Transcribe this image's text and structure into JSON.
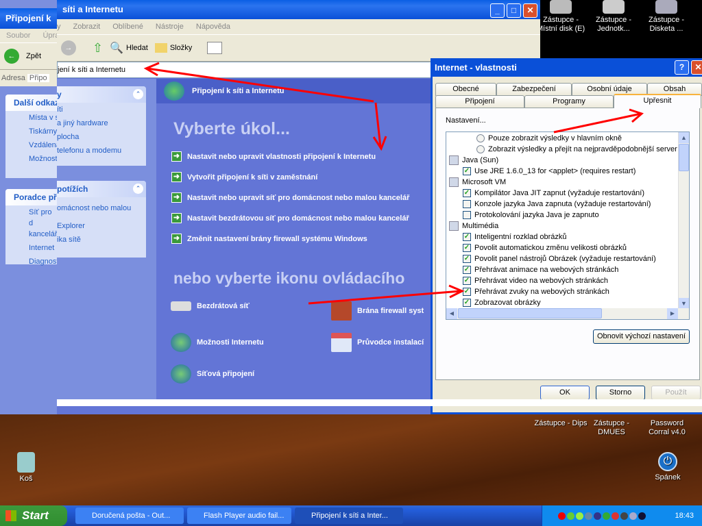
{
  "desktop": {
    "top_icons": [
      {
        "label": "Zástupce - Místní disk (E)"
      },
      {
        "label": "Zástupce - Jednotk..."
      },
      {
        "label": "Zástupce - Disketa ..."
      }
    ],
    "bottom_icons": [
      {
        "label": "Zástupce - Dips"
      },
      {
        "label": "Zástupce - DMUES"
      },
      {
        "label": "Password Corral v4.0"
      }
    ],
    "recycle": "Koš",
    "sleep": "Spánek"
  },
  "ghost_window": {
    "title": "Připojení k",
    "menu": [
      "Soubor",
      "Úpravy"
    ],
    "back": "Zpět",
    "address_label": "Adresa",
    "address": "Připo",
    "pane1_title": "Další odkazy",
    "pane1_items": [
      "Místa v síti",
      "Tiskárny",
      "Vzdálená",
      "Možnosti"
    ],
    "pane2_title": "Poradce při",
    "pane2_items": [
      "Síť pro d kancelář",
      "Internet",
      "Diagnost"
    ]
  },
  "explorer": {
    "title": "síti a Internetu",
    "menu": [
      "y",
      "Zobrazit",
      "Oblíbené",
      "Nástroje",
      "Nápověda"
    ],
    "toolbar": {
      "search": "Hledat",
      "folders": "Složky"
    },
    "address": "jení k síti a Internetu",
    "pane1": {
      "title": "y",
      "items": [
        "íti",
        "a jiný hardware",
        "plocha",
        "telefonu a modemu"
      ]
    },
    "pane2": {
      "title": "potížích",
      "items": [
        "omácnost nebo malou",
        "Explorer",
        "ika sítě"
      ]
    },
    "header": "Připojení k síti a Internetu",
    "heading": "Vyberte úkol...",
    "tasks": [
      "Nastavit nebo upravit vlastnosti připojení k Internetu",
      "Vytvořit připojení k síti v zaměstnání",
      "Nastavit nebo upravit síť pro domácnost nebo malou kancelář",
      "Nastavit bezdrátovou síť pro domácnost nebo malou kancelář",
      "Změnit nastavení brány firewall systému Windows"
    ],
    "heading2": "nebo vyberte ikonu ovládacího",
    "icons": [
      "Bezdrátová síť",
      "Brána firewall syst",
      "Možnosti Internetu",
      "Průvodce instalací",
      "Síťová připojení"
    ]
  },
  "dialog": {
    "title": "Internet - vlastnosti",
    "tabs_row1": [
      "Obecné",
      "Zabezpečení",
      "Osobní údaje",
      "Obsah"
    ],
    "tabs_row2": [
      "Připojení",
      "Programy",
      "Upřesnit"
    ],
    "active_tab": "Upřesnit",
    "settings_label": "Nastavení...",
    "items": [
      {
        "type": "radio",
        "checked": false,
        "label": "Pouze zobrazit výsledky v hlavním okně"
      },
      {
        "type": "radio",
        "checked": false,
        "label": "Zobrazit výsledky a přejít na nejpravděpodobnější server"
      },
      {
        "type": "group",
        "label": "Java (Sun)"
      },
      {
        "type": "check",
        "checked": true,
        "label": "Use JRE 1.6.0_13 for <applet> (requires restart)"
      },
      {
        "type": "group",
        "label": "Microsoft VM"
      },
      {
        "type": "check",
        "checked": true,
        "label": "Kompilátor Java JIT zapnut (vyžaduje restartování)"
      },
      {
        "type": "check",
        "checked": false,
        "label": "Konzole jazyka Java zapnuta (vyžaduje restartování)"
      },
      {
        "type": "check",
        "checked": false,
        "label": "Protokolování jazyka Java je zapnuto"
      },
      {
        "type": "group",
        "label": "Multimédia"
      },
      {
        "type": "check",
        "checked": true,
        "label": "Inteligentní rozklad obrázků"
      },
      {
        "type": "check",
        "checked": true,
        "label": "Povolit automatickou změnu velikosti obrázků"
      },
      {
        "type": "check",
        "checked": true,
        "label": "Povolit panel nástrojů Obrázek (vyžaduje restartování)"
      },
      {
        "type": "check",
        "checked": true,
        "label": "Přehrávat animace na webových stránkách"
      },
      {
        "type": "check",
        "checked": true,
        "label": "Přehrávat video na webových stránkách"
      },
      {
        "type": "check",
        "checked": true,
        "label": "Přehrávat zvuky na webových stránkách"
      },
      {
        "type": "check",
        "checked": true,
        "label": "Zobrazovat obrázky"
      }
    ],
    "reset": "Obnovit výchozí nastavení",
    "ok": "OK",
    "cancel": "Storno",
    "apply": "Použít"
  },
  "taskbar": {
    "start": "Start",
    "items": [
      "Doručená pošta - Out...",
      "Flash Player audio fail...",
      "Připojení k síti a Inter..."
    ],
    "clock": "18:43"
  },
  "colors": {
    "annotation_arrow": "#ff0000",
    "xp_blue": "#0a50d8"
  }
}
